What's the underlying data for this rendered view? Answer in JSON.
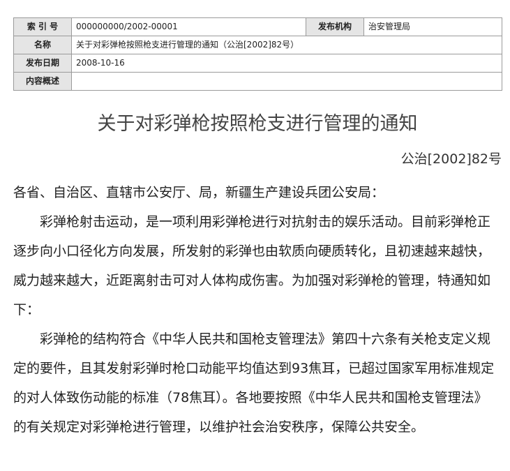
{
  "meta": {
    "index_label": "索 引 号",
    "index_value": "000000000/2002-00001",
    "publisher_label": "发布机构",
    "publisher_value": "治安管理局",
    "name_label": "名称",
    "name_value": "关于对彩弹枪按照枪支进行管理的通知（公治[2002]82号）",
    "date_label": "发布日期",
    "date_value": "2008-10-16",
    "summary_label": "内容概述",
    "summary_value": ""
  },
  "document": {
    "title": "关于对彩弹枪按照枪支进行管理的通知",
    "number": "公治[2002]82号",
    "salutation": "各省、自治区、直辖市公安厅、局，新疆生产建设兵团公安局：",
    "paragraphs": [
      "彩弹枪射击运动，是一项利用彩弹枪进行对抗射击的娱乐活动。目前彩弹枪正逐步向小口径化方向发展，所发射的彩弹也由软质向硬质转化，且初速越来越快，威力越来越大，近距离射击可对人体构成伤害。为加强对彩弹枪的管理，特通知如下：",
      "彩弹枪的结构符合《中华人民共和国枪支管理法》第四十六条有关枪支定义规定的要件，且其发射彩弹时枪口动能平均值达到93焦耳，已超过国家军用标准规定的对人体致伤动能的标准（78焦耳）。各地要按照《中华人民共和国枪支管理法》的有关规定对彩弹枪进行管理，以维护社会治安秩序，保障公共安全。"
    ]
  }
}
